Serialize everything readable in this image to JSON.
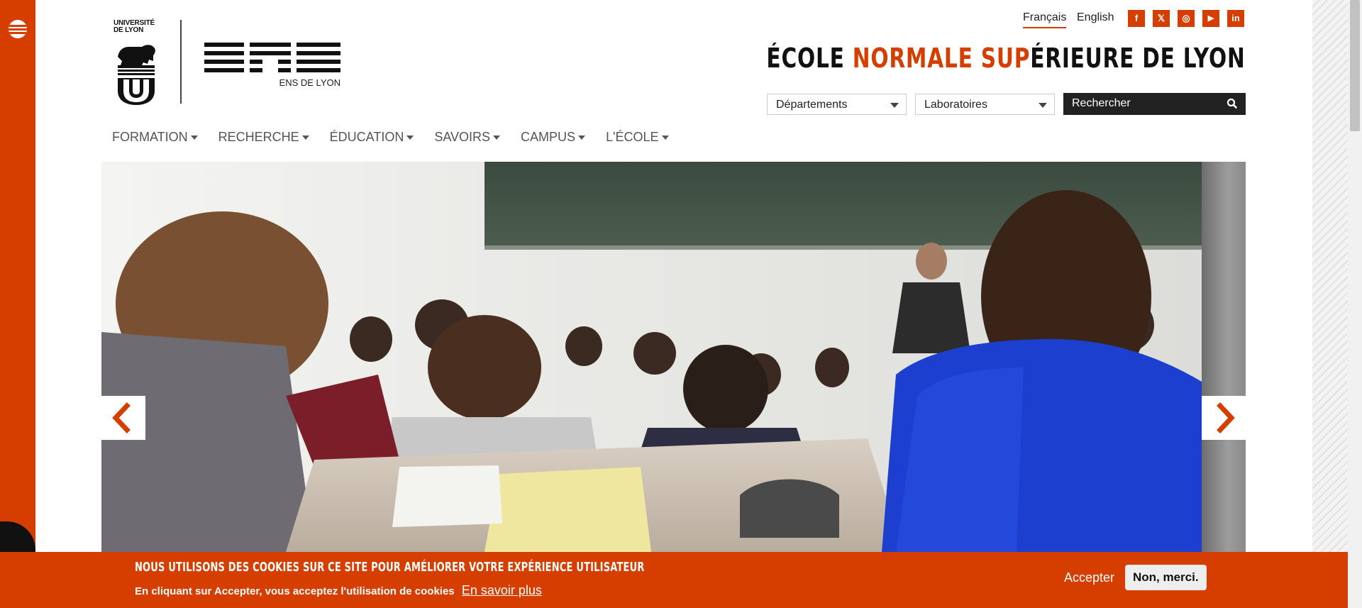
{
  "header": {
    "logo_univ_text": [
      "UNIVERSITÉ",
      "DE LYON"
    ],
    "logo_ens_caption": "ENS DE LYON",
    "languages": [
      "Français",
      "English"
    ],
    "social_icons": [
      {
        "name": "facebook-icon",
        "glyph": "f"
      },
      {
        "name": "x-twitter-icon",
        "glyph": "𝕏"
      },
      {
        "name": "instagram-icon",
        "glyph": "◎"
      },
      {
        "name": "youtube-icon",
        "glyph": "▶"
      },
      {
        "name": "linkedin-icon",
        "glyph": "in"
      }
    ],
    "title_parts": {
      "part1": "ÉCOLE ",
      "part2": "NORMALE SUP",
      "part3": "ÉRIEURE DE LYON"
    },
    "select_departements": "Départements",
    "select_laboratoires": "Laboratoires",
    "search_placeholder": "Rechercher"
  },
  "nav": {
    "items": [
      "FORMATION",
      "RECHERCHE",
      "ÉDUCATION",
      "SAVOIRS",
      "CAMPUS",
      "L'ÉCOLE"
    ]
  },
  "cookie": {
    "title": "NOUS UTILISONS DES COOKIES SUR CE SITE POUR AMÉLIORER VOTRE EXPÉRIENCE UTILISATEUR",
    "text": "En cliquant sur Accepter, vous acceptez l'utilisation de cookies",
    "link": "En savoir plus",
    "accept_label": "Accepter",
    "decline_label": "Non, merci."
  },
  "colors": {
    "accent": "#d63e00",
    "dark": "#222222"
  }
}
